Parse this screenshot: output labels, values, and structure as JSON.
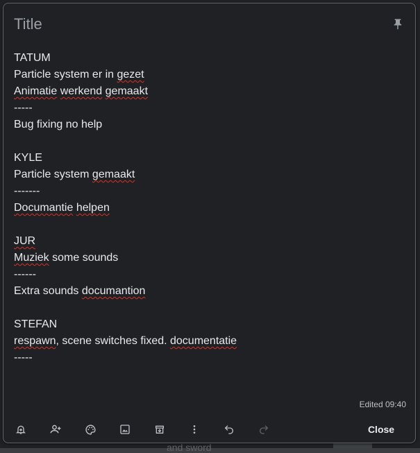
{
  "note": {
    "title_placeholder": "Title",
    "edited_label": "Edited 09:40",
    "close_label": "Close",
    "lines": [
      [
        {
          "t": "TATUM"
        }
      ],
      [
        {
          "t": "Particle system er in "
        },
        {
          "t": "gezet",
          "spell": true
        }
      ],
      [
        {
          "t": "Animatie",
          "spell": true
        },
        {
          "t": " "
        },
        {
          "t": "werkend",
          "spell": true
        },
        {
          "t": " "
        },
        {
          "t": "gemaakt",
          "spell": true
        }
      ],
      [
        {
          "t": "-----"
        }
      ],
      [
        {
          "t": "Bug fixing no help"
        }
      ],
      [
        {
          "t": ""
        }
      ],
      [
        {
          "t": "KYLE"
        }
      ],
      [
        {
          "t": "Particle system "
        },
        {
          "t": "gemaakt",
          "spell": true
        }
      ],
      [
        {
          "t": "-------"
        }
      ],
      [
        {
          "t": "Documantie",
          "spell": true
        },
        {
          "t": " "
        },
        {
          "t": "helpen",
          "spell": true
        }
      ],
      [
        {
          "t": ""
        }
      ],
      [
        {
          "t": "JUR",
          "spell": true
        }
      ],
      [
        {
          "t": "Muziek",
          "spell": true
        },
        {
          "t": " some sounds"
        }
      ],
      [
        {
          "t": "------"
        }
      ],
      [
        {
          "t": "Extra sounds "
        },
        {
          "t": "documantion",
          "spell": true
        }
      ],
      [
        {
          "t": ""
        }
      ],
      [
        {
          "t": "STEFAN"
        }
      ],
      [
        {
          "t": "respawn",
          "spell": true
        },
        {
          "t": ", scene switches fixed. "
        },
        {
          "t": "documentatie",
          "spell": true
        }
      ],
      [
        {
          "t": "-----"
        }
      ]
    ]
  },
  "toolbar": {
    "icons": [
      "remind-me-icon",
      "collaborator-icon",
      "palette-icon",
      "image-icon",
      "archive-icon",
      "more-icon",
      "undo-icon",
      "redo-icon"
    ]
  },
  "background": {
    "peek_text": "and sword"
  },
  "colors": {
    "surface": "#202124",
    "border": "#5f6368",
    "text": "#e8eaed",
    "muted": "#9aa0a6",
    "spellcheck": "#d93025"
  }
}
